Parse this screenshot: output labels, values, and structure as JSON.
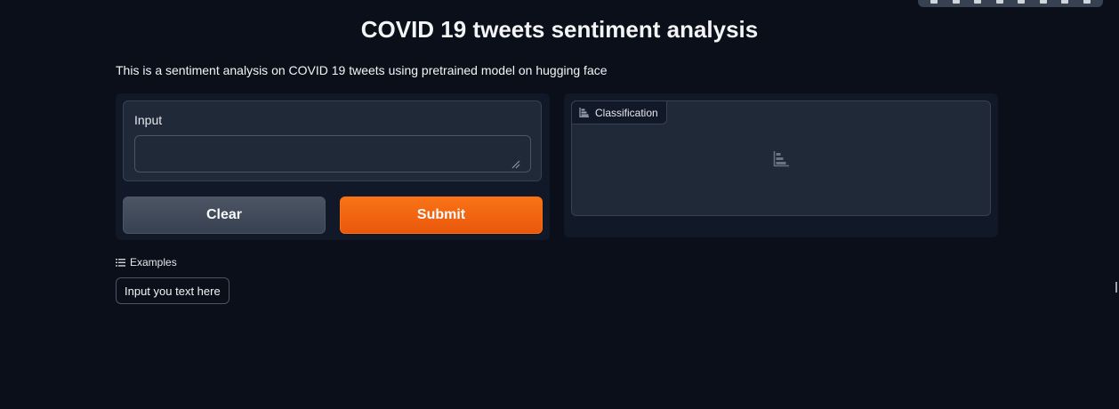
{
  "page": {
    "title": "COVID 19 tweets sentiment analysis",
    "description": "This is a sentiment analysis on COVID 19 tweets using pretrained model on hugging face"
  },
  "input": {
    "label": "Input",
    "value": "",
    "placeholder": ""
  },
  "buttons": {
    "clear_label": "Clear",
    "submit_label": "Submit"
  },
  "output": {
    "label": "Classification",
    "icon": "bar-chart-icon"
  },
  "examples": {
    "label": "Examples",
    "icon": "list-icon",
    "items": [
      "Input you text here"
    ]
  },
  "colors": {
    "background": "#0b0f19",
    "panel": "#111827",
    "block": "#1f2937",
    "accent": "#f97316",
    "secondary_button": "#4b5563"
  }
}
